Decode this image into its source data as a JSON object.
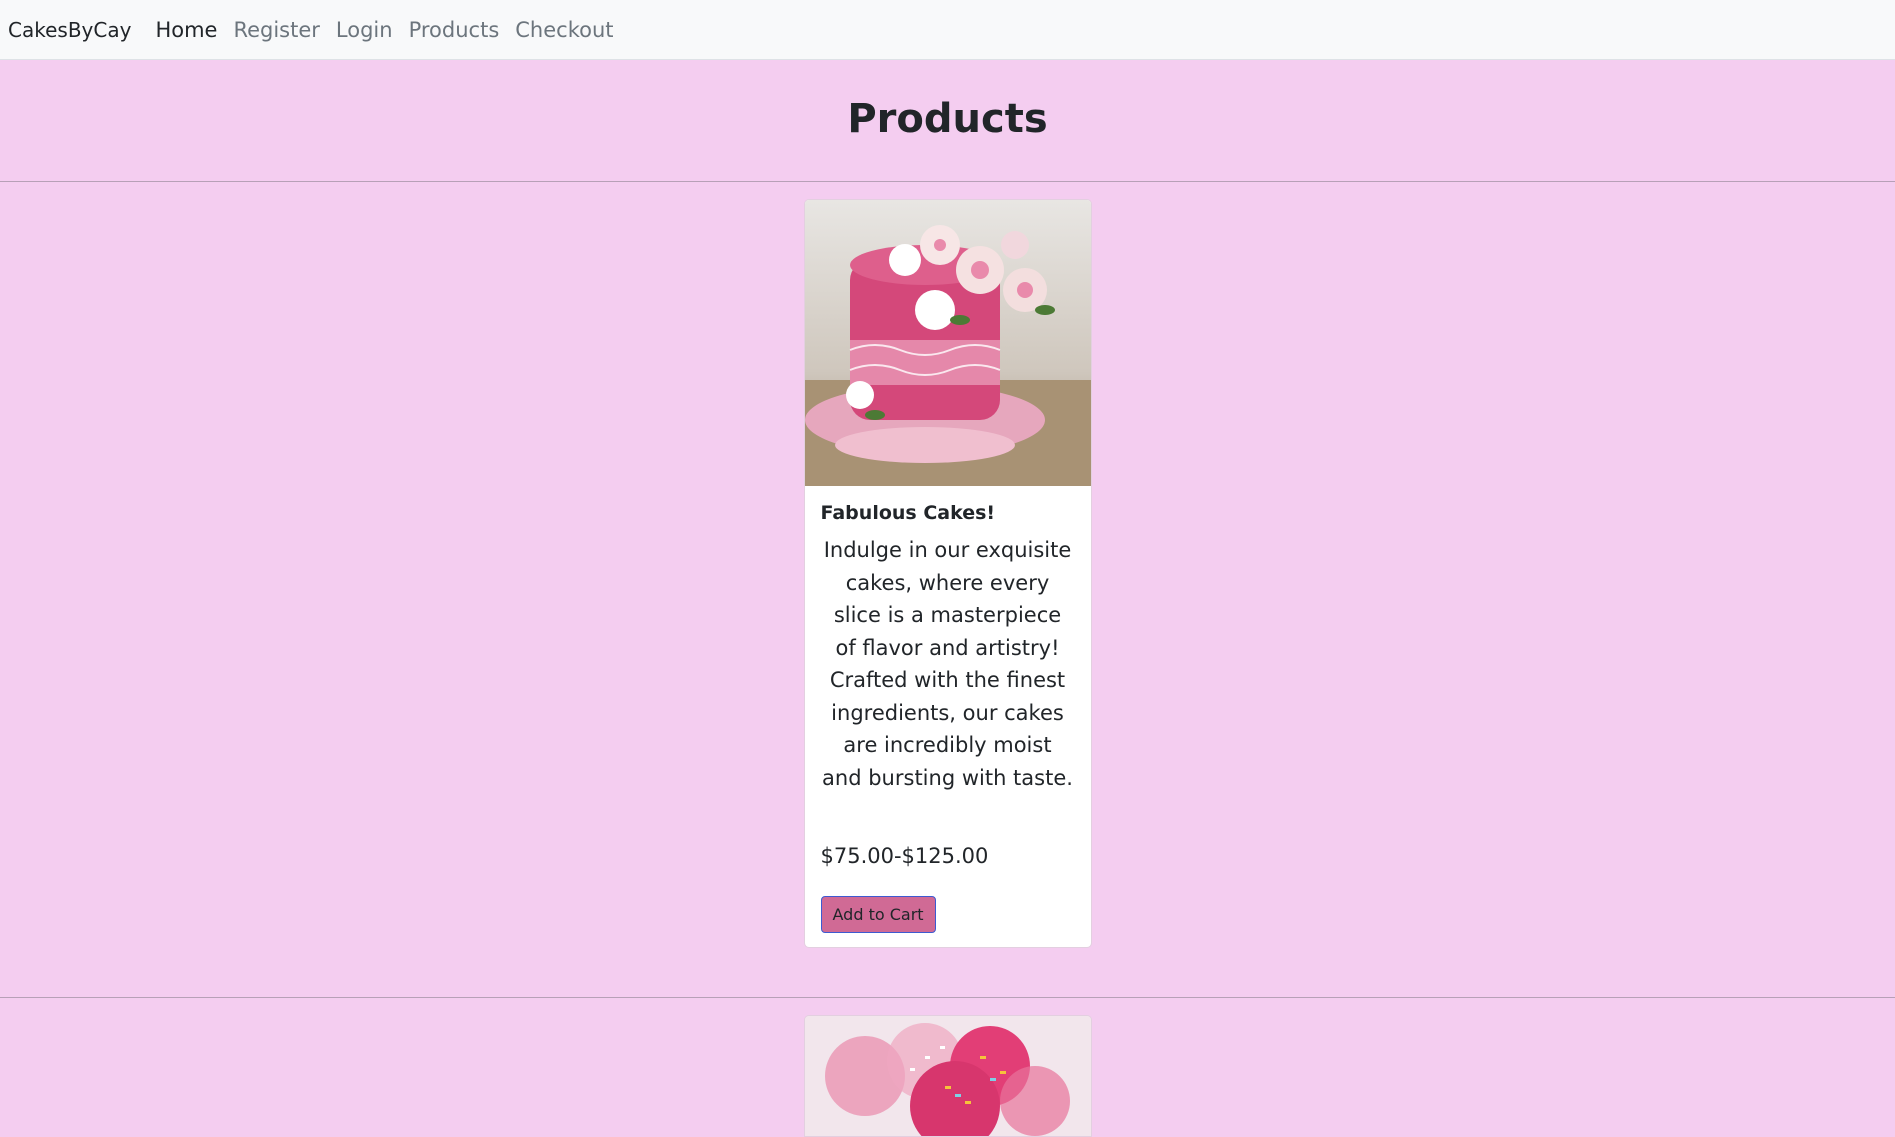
{
  "nav": {
    "brand": "CakesByCay",
    "links": [
      "Home",
      "Register",
      "Login",
      "Products",
      "Checkout"
    ]
  },
  "page": {
    "title": "Products"
  },
  "products": [
    {
      "title": "Fabulous Cakes!",
      "description": "Indulge in our exquisite cakes, where every slice is a masterpiece of flavor and artistry! Crafted with the finest ingredients, our cakes are incredibly moist and bursting with taste.",
      "price": "$75.00-$125.00",
      "button": "Add to Cart"
    }
  ],
  "colors": {
    "background": "#f4cdf0",
    "button": "#d06a95",
    "navbar": "#f8f9fa"
  }
}
